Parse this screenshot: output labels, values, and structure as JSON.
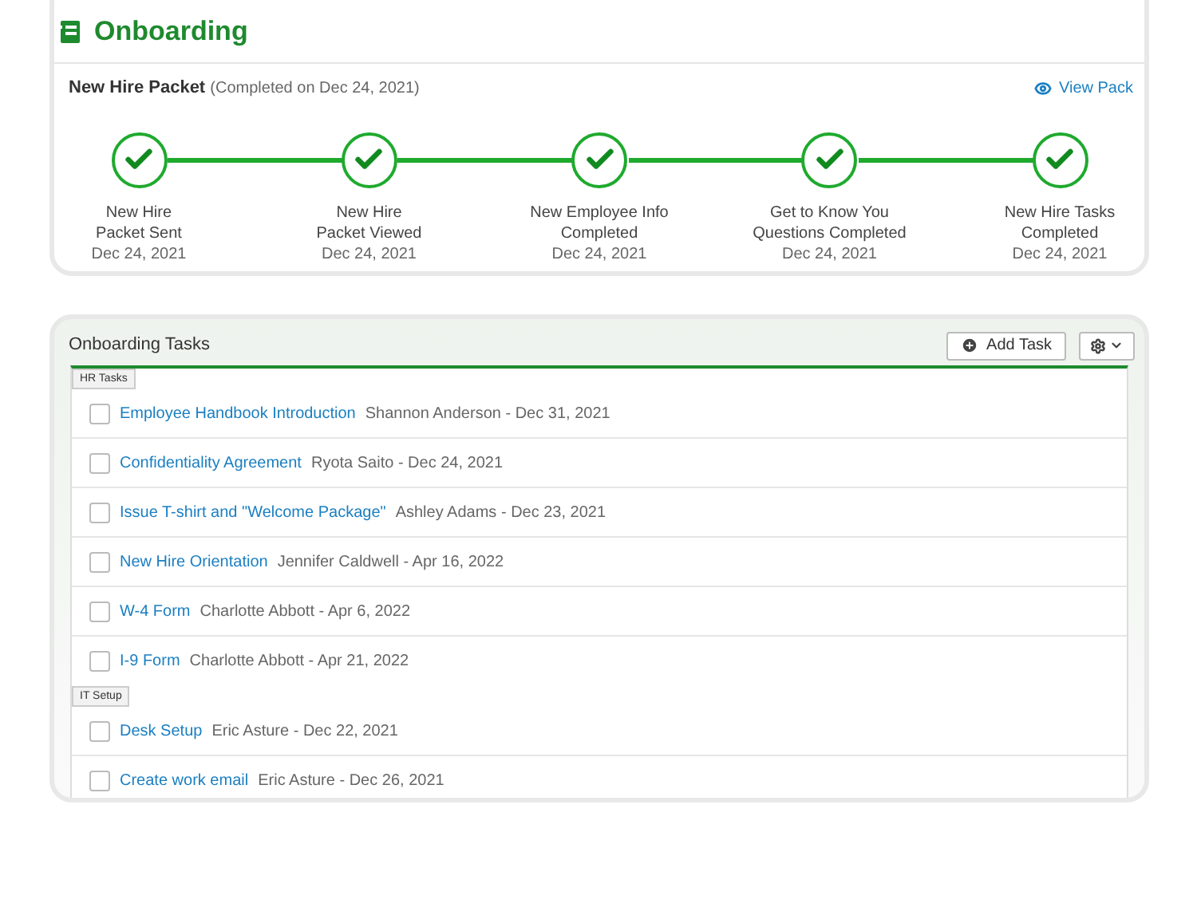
{
  "header": {
    "title": "Onboarding"
  },
  "packet": {
    "title": "New Hire Packet",
    "note": "(Completed on Dec 24, 2021)",
    "link": "View Pack"
  },
  "steps": [
    {
      "label": "New Hire\nPacket Sent",
      "date": "Dec 24, 2021",
      "completed": true
    },
    {
      "label": "New Hire\nPacket Viewed",
      "date": "Dec 24, 2021",
      "completed": true
    },
    {
      "label": "New Employee Info\nCompleted",
      "date": "Dec 24, 2021",
      "completed": true
    },
    {
      "label": "Get to Know You\nQuestions Completed",
      "date": "Dec 24, 2021",
      "completed": true
    },
    {
      "label": "New Hire Tasks\nCompleted",
      "date": "Dec 24, 2021",
      "completed": true
    }
  ],
  "tasks_panel": {
    "title": "Onboarding Tasks",
    "add_button": "Add Task",
    "groups": [
      {
        "name": "HR Tasks",
        "tasks": [
          {
            "title": "Employee Handbook Introduction",
            "meta": "Shannon Anderson - Dec 31, 2021",
            "checked": false
          },
          {
            "title": "Confidentiality Agreement",
            "meta": "Ryota Saito - Dec 24, 2021",
            "checked": false
          },
          {
            "title": "Issue T-shirt and \"Welcome Package\"",
            "meta": "Ashley Adams - Dec 23, 2021",
            "checked": false
          },
          {
            "title": "New Hire Orientation",
            "meta": "Jennifer Caldwell - Apr 16, 2022",
            "checked": false
          },
          {
            "title": "W-4 Form",
            "meta": "Charlotte Abbott - Apr 6, 2022",
            "checked": false
          },
          {
            "title": "I-9 Form",
            "meta": "Charlotte Abbott - Apr 21, 2022",
            "checked": false
          }
        ]
      },
      {
        "name": "IT Setup",
        "tasks": [
          {
            "title": "Desk Setup",
            "meta": "Eric Asture - Dec 22, 2021",
            "checked": false
          },
          {
            "title": "Create work email",
            "meta": "Eric Asture - Dec 26, 2021",
            "checked": false
          }
        ]
      }
    ]
  }
}
